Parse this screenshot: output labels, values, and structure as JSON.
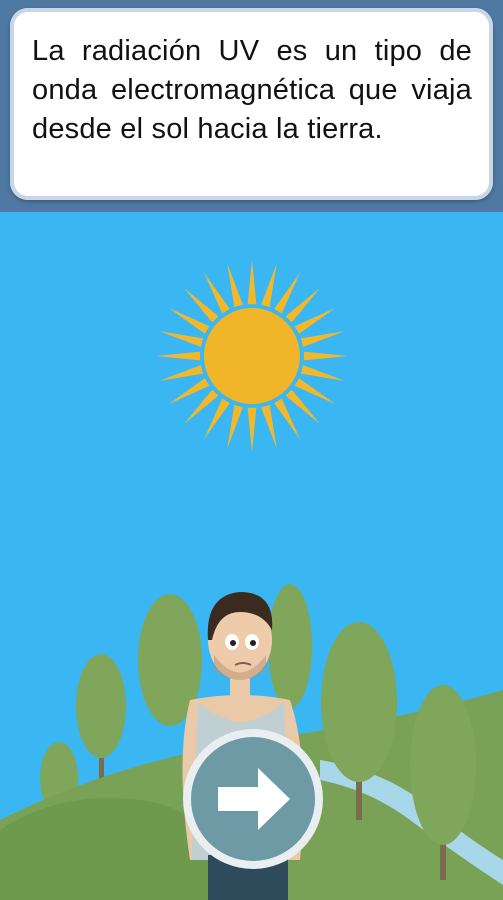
{
  "info_card": {
    "text": "La radiación UV es un tipo de onda electromagnética que viaja desde el sol hacia la tierra."
  },
  "colors": {
    "sky": "#3ab6f2",
    "header": "#4f79a3",
    "sun": "#f2b82c",
    "hill": "#7fa65a",
    "tree": "#7fa65a",
    "river": "#a8d7ea",
    "button": "#6e9aa6"
  },
  "next_button": {
    "icon": "arrow-right-icon"
  }
}
